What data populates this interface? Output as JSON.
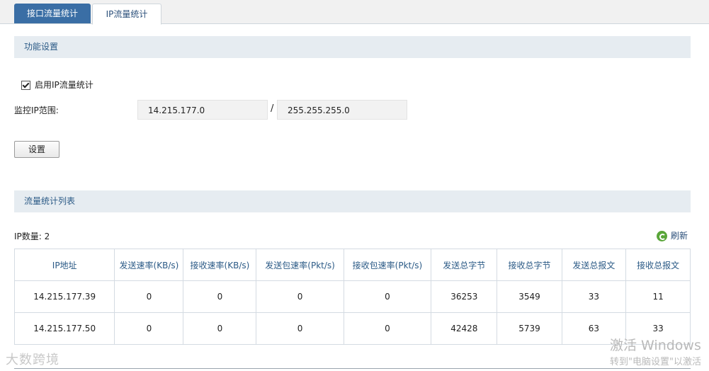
{
  "tabs": [
    {
      "label": "接口流量统计",
      "active": true
    },
    {
      "label": "IP流量统计",
      "active": false
    }
  ],
  "feature_section": {
    "title": "功能设置"
  },
  "enable_ip_stats": {
    "label": "启用IP流量统计",
    "checked": true
  },
  "monitor_range": {
    "label": "监控IP范围:",
    "ip": "14.215.177.0",
    "separator": "/",
    "mask": "255.255.255.0"
  },
  "set_button": {
    "label": "设置"
  },
  "stats_section": {
    "title": "流量统计列表"
  },
  "ip_count": {
    "label": "IP数量: 2"
  },
  "refresh": {
    "label": "刷新",
    "icon": "refresh-icon"
  },
  "table": {
    "headers": [
      "IP地址",
      "发送速率(KB/s)",
      "接收速率(KB/s)",
      "发送包速率(Pkt/s)",
      "接收包速率(Pkt/s)",
      "发送总字节",
      "接收总字节",
      "发送总报文",
      "接收总报文"
    ],
    "rows": [
      [
        "14.215.177.39",
        "0",
        "0",
        "0",
        "0",
        "36253",
        "3549",
        "33",
        "11"
      ],
      [
        "14.215.177.50",
        "0",
        "0",
        "0",
        "0",
        "42428",
        "5739",
        "63",
        "33"
      ]
    ]
  },
  "watermark": {
    "logo_text": "大数跨境"
  },
  "windows_activation": {
    "line1": "激活 Windows",
    "line2": "转到\"电脑设置\"以激活"
  },
  "colors": {
    "accent": "#3a6ea5",
    "section_bg": "#e6ecf1",
    "refresh_green": "#5aa63a"
  }
}
